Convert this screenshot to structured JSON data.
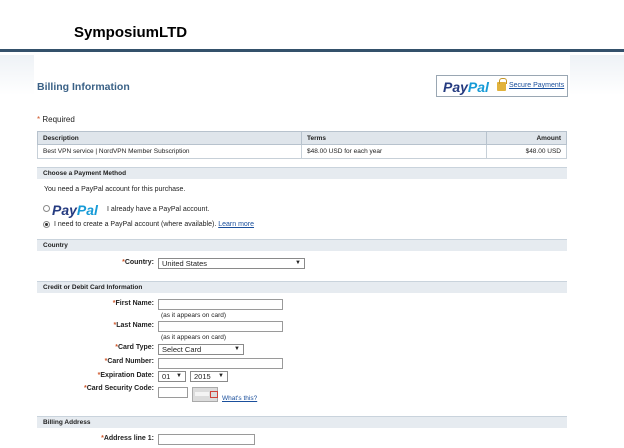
{
  "header": {
    "brand": "SymposiumLTD"
  },
  "billing": {
    "title": "Billing Information",
    "paypal_logo_a": "Pay",
    "paypal_logo_b": "Pal",
    "secure_label": "Secure Payments",
    "required_label": "Required"
  },
  "items_table": {
    "headers": {
      "description": "Description",
      "terms": "Terms",
      "amount": "Amount"
    },
    "rows": [
      {
        "description": "Best VPN service | NordVPN Member Subscription",
        "terms": "$48.00 USD for each year",
        "amount": "$48.00 USD"
      }
    ]
  },
  "payment_method": {
    "section_title": "Choose a Payment Method",
    "intro": "You need a PayPal account for this purchase.",
    "option_have_account": "I already have a PayPal account.",
    "option_create_account": "I need to create a PayPal account (where available).",
    "learn_more": "Learn more",
    "selected": "create"
  },
  "country": {
    "section_title": "Country",
    "label": "Country:",
    "value": "United States"
  },
  "card": {
    "section_title": "Credit or Debit Card Information",
    "first_name_label": "First Name:",
    "first_name_value": "",
    "last_name_label": "Last Name:",
    "last_name_value": "",
    "as_appears_hint": "(as it appears on card)",
    "card_type_label": "Card Type:",
    "card_type_value": "Select Card",
    "card_number_label": "Card Number:",
    "expiration_label": "Expiration Date:",
    "exp_month": "01",
    "exp_year": "2015",
    "security_code_label": "Card Security Code:",
    "whats_this": "What's this?"
  },
  "billing_address": {
    "section_title": "Billing Address",
    "address1_label": "Address line 1:"
  },
  "colors": {
    "accent": "#3a6186",
    "header_rule": "#34516b",
    "required_star": "#d0582c"
  }
}
